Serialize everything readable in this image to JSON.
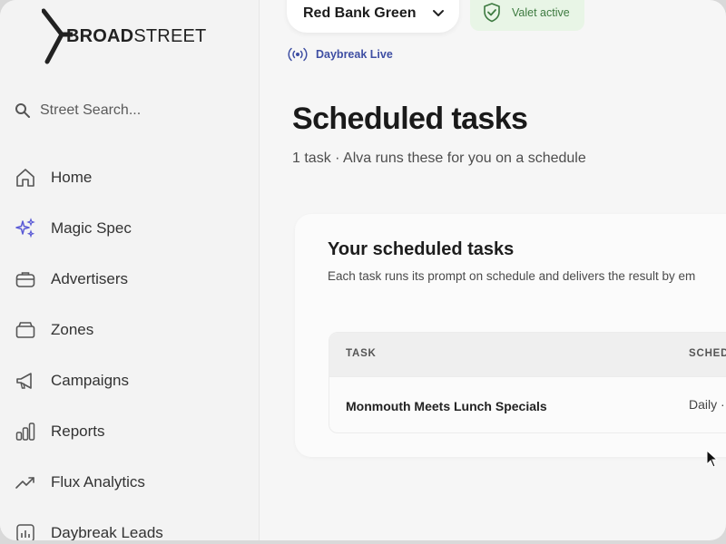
{
  "app": {
    "logo_bold": "BROAD",
    "logo_light": "STREET"
  },
  "search": {
    "placeholder": "Street Search..."
  },
  "sidebar": {
    "items": [
      {
        "label": "Home",
        "icon": "home-icon"
      },
      {
        "label": "Magic Spec",
        "icon": "sparkles-icon"
      },
      {
        "label": "Advertisers",
        "icon": "briefcase-icon"
      },
      {
        "label": "Zones",
        "icon": "inbox-icon"
      },
      {
        "label": "Campaigns",
        "icon": "megaphone-icon"
      },
      {
        "label": "Reports",
        "icon": "bar-chart-icon"
      },
      {
        "label": "Flux Analytics",
        "icon": "trending-up-icon"
      },
      {
        "label": "Daybreak Leads",
        "icon": "chart-icon"
      }
    ]
  },
  "topbar": {
    "location": "Red Bank Green",
    "valet_status": "Valet active",
    "live_label": "Daybreak Live"
  },
  "main": {
    "title": "Scheduled tasks",
    "subtitle": "1 task · Alva runs these for you on a schedule",
    "card": {
      "title": "Your scheduled tasks",
      "description": "Each task runs its prompt on schedule and delivers the result by em",
      "columns": [
        "TASK",
        "SCHED"
      ],
      "rows": [
        {
          "task": "Monmouth Meets Lunch Specials",
          "schedule": "Daily ·"
        }
      ]
    }
  },
  "colors": {
    "accent_purple": "#5b5bd6",
    "valet_green": "#3d7a40",
    "live_blue": "#3f4fa3"
  }
}
